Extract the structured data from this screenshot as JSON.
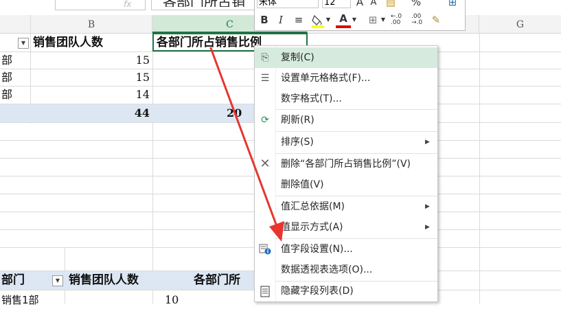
{
  "formula_bar": {
    "name_box_value": "",
    "fx_symbol": "fx",
    "formula_value": "各部门所占销"
  },
  "columns": {
    "b": "B",
    "c": "C",
    "g": "G"
  },
  "pivot_top": {
    "header_value_label": "销售团队人数",
    "header_ratio_label": "各部门所占销售比例",
    "rows": [
      {
        "label": "部",
        "value": "15"
      },
      {
        "label": "部",
        "value": "15"
      },
      {
        "label": "部",
        "value": "14"
      }
    ],
    "total_value": "44",
    "total_ratio_partial": "20"
  },
  "pivot_bottom": {
    "header_dept_label": "部门",
    "header_value_label": "销售团队人数",
    "header_ratio_label": "各部门所",
    "first_row_label": "销售1部",
    "first_row_value": "10"
  },
  "mini_toolbar": {
    "font_name": "宋体",
    "font_size": "12",
    "grow_font": "A",
    "shrink_font": "A",
    "percent": "%",
    "bold": "B",
    "italic": "I",
    "font_color_letter": "A",
    "increase_decimal": ".00\n←.0",
    "decrease_decimal": ".00\n→.0",
    "fill_color": "#ffff00",
    "font_color": "#e00000"
  },
  "context_menu": {
    "items": [
      {
        "label": "复制(C)",
        "icon": "copy-icon"
      },
      {
        "label": "设置单元格格式(F)...",
        "icon": "format-cells-icon"
      },
      {
        "label": "数字格式(T)...",
        "icon": ""
      },
      {
        "label": "刷新(R)",
        "icon": "refresh-icon"
      },
      {
        "label": "排序(S)",
        "icon": "",
        "submenu": true
      },
      {
        "label": "删除“各部门所占销售比例”(V)",
        "icon": "delete-x-icon"
      },
      {
        "label": "删除值(V)",
        "icon": ""
      },
      {
        "label": "值汇总依据(M)",
        "icon": "",
        "submenu": true
      },
      {
        "label": "值显示方式(A)",
        "icon": "",
        "submenu": true
      },
      {
        "label": "值字段设置(N)...",
        "icon": "field-settings-icon"
      },
      {
        "label": "数据透视表选项(O)...",
        "icon": ""
      },
      {
        "label": "隐藏字段列表(D)",
        "icon": "field-list-icon"
      }
    ],
    "submenu_arrow": "▶"
  },
  "colors": {
    "accent_green": "#217346",
    "menu_highlight": "#d6ebdd",
    "pivot_band": "#dde7f4",
    "annotation_red": "#e8352e"
  }
}
